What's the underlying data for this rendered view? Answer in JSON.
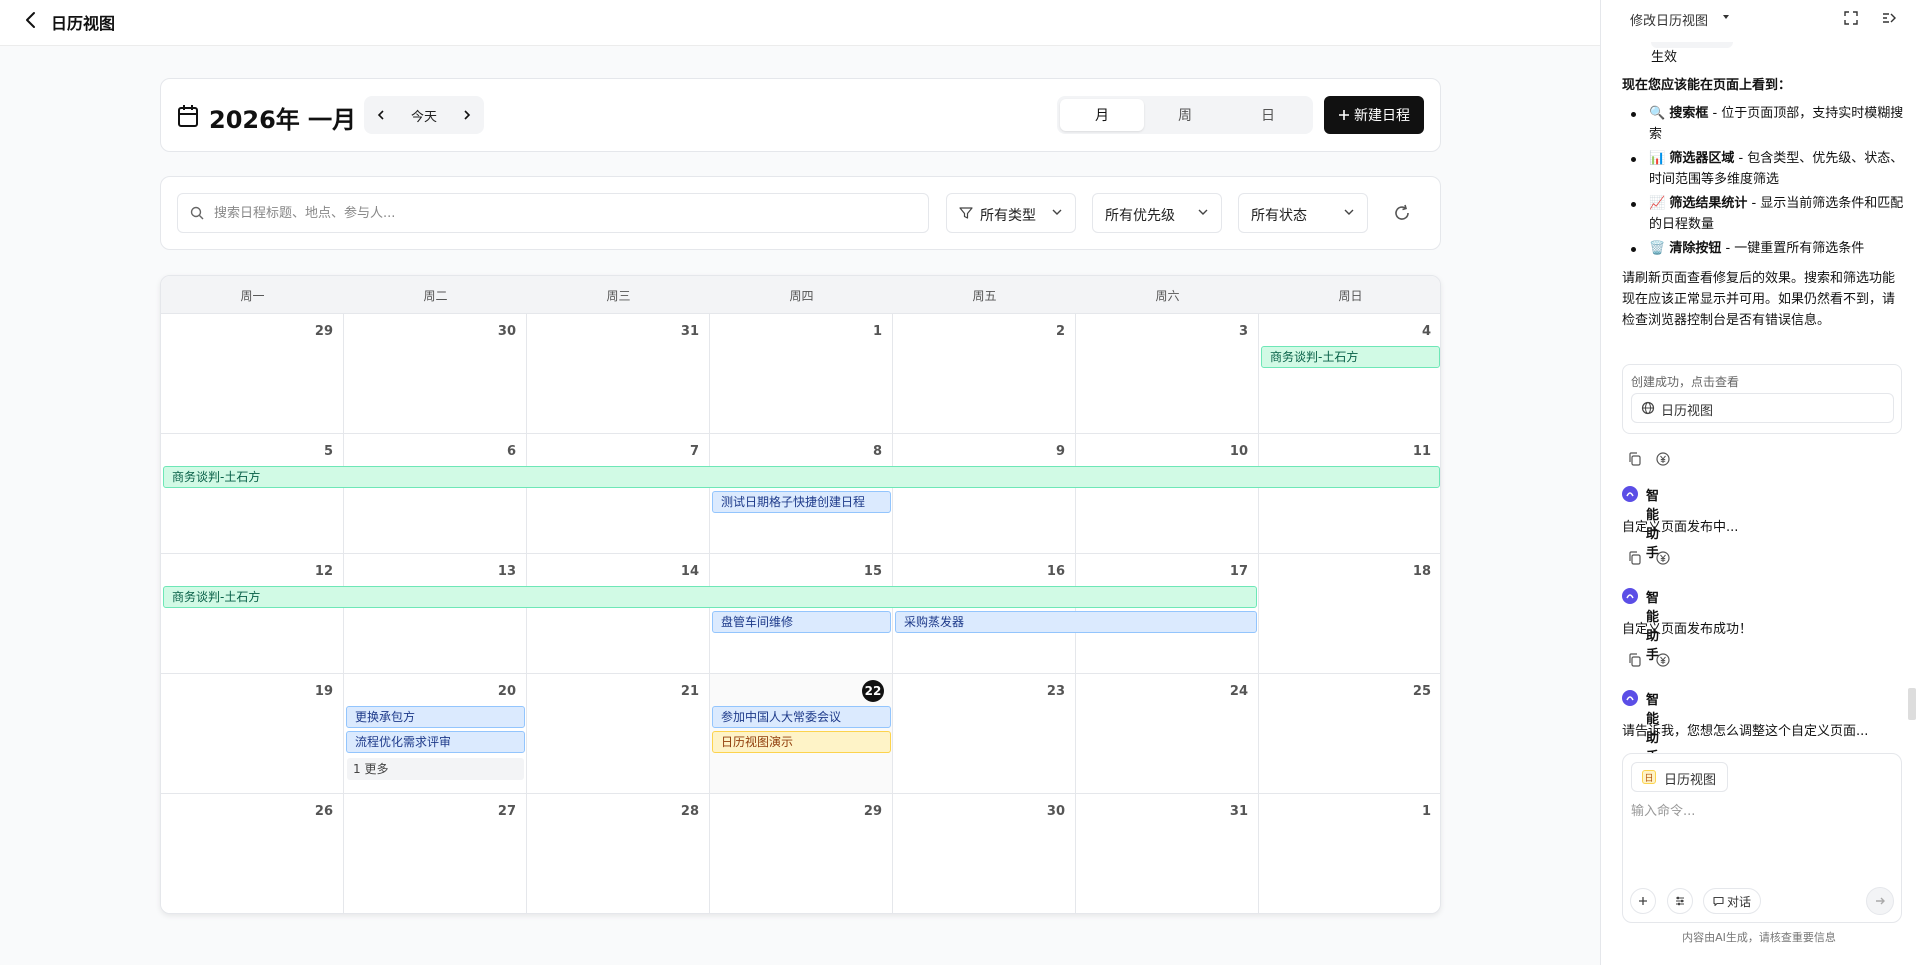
{
  "page": {
    "title": "日历视图"
  },
  "calendar": {
    "month_title": "2026年 一月",
    "today_label": "今天",
    "views": [
      "月",
      "周",
      "日"
    ],
    "active_view": "月",
    "new_button": "新建日程",
    "search_placeholder": "搜索日程标题、地点、参与人...",
    "filters": {
      "type": "所有类型",
      "priority": "所有优先级",
      "status": "所有状态"
    },
    "weekdays": [
      "周一",
      "周二",
      "周三",
      "周四",
      "周五",
      "周六",
      "周日"
    ],
    "weeks": [
      [
        "29",
        "30",
        "31",
        "1",
        "2",
        "3",
        "4"
      ],
      [
        "5",
        "6",
        "7",
        "8",
        "9",
        "10",
        "11"
      ],
      [
        "12",
        "13",
        "14",
        "15",
        "16",
        "17",
        "18"
      ],
      [
        "19",
        "20",
        "21",
        "22",
        "23",
        "24",
        "25"
      ],
      [
        "26",
        "27",
        "28",
        "29",
        "30",
        "31",
        "1"
      ]
    ],
    "today": {
      "week": 3,
      "day": 3
    },
    "colors": {
      "green": "#d1fae5",
      "blue": "#dbeafe",
      "yellow": "#fef3c7"
    },
    "events": [
      {
        "title": "商务谈判-土石方",
        "week": 0,
        "start": 6,
        "span": 1,
        "lane": 0,
        "color": "green"
      },
      {
        "title": "商务谈判-土石方",
        "week": 1,
        "start": 0,
        "span": 7,
        "lane": 0,
        "color": "green"
      },
      {
        "title": "测试日期格子快捷创建日程",
        "week": 1,
        "start": 3,
        "span": 1,
        "lane": 1,
        "color": "blue"
      },
      {
        "title": "商务谈判-土石方",
        "week": 2,
        "start": 0,
        "span": 6,
        "lane": 0,
        "color": "green"
      },
      {
        "title": "盘管车间维修",
        "week": 2,
        "start": 3,
        "span": 1,
        "lane": 1,
        "color": "blue"
      },
      {
        "title": "采购蒸发器",
        "week": 2,
        "start": 4,
        "span": 2,
        "lane": 1,
        "color": "blue"
      },
      {
        "title": "更换承包方",
        "week": 3,
        "start": 1,
        "span": 1,
        "lane": 0,
        "color": "blue"
      },
      {
        "title": "流程优化需求评审",
        "week": 3,
        "start": 1,
        "span": 1,
        "lane": 1,
        "color": "blue"
      },
      {
        "title": "参加中国人大常委会议",
        "week": 3,
        "start": 3,
        "span": 1,
        "lane": 0,
        "color": "blue"
      },
      {
        "title": "日历视图演示",
        "week": 3,
        "start": 3,
        "span": 1,
        "lane": 1,
        "color": "yellow"
      }
    ],
    "more": [
      {
        "label": "1 更多",
        "week": 3,
        "day": 1,
        "lane": 2
      }
    ]
  },
  "panel": {
    "title": "修改日历视图",
    "prev_tail": "生效",
    "intro": "现在您应该能在页面上看到：",
    "bullets": [
      {
        "emoji": "🔍",
        "bold": "搜索框",
        "text": " - 位于页面顶部，支持实时模糊搜索"
      },
      {
        "emoji": "📊",
        "bold": "筛选器区域",
        "text": " - 包含类型、优先级、状态、时间范围等多维度筛选"
      },
      {
        "emoji": "📈",
        "bold": "筛选结果统计",
        "text": " - 显示当前筛选条件和匹配的日程数量"
      },
      {
        "emoji": "🗑️",
        "bold": "清除按钮",
        "text": " - 一键重置所有筛选条件"
      }
    ],
    "summary": "请刷新页面查看修复后的效果。搜索和筛选功能现在应该正常显示并可用。如果仍然看不到，请检查浏览器控制台是否有错误信息。",
    "created_label": "创建成功，点击查看",
    "created_link": "日历视图",
    "assistant_name": "智能助手",
    "messages": [
      "自定义页面发布中...",
      "自定义页面发布成功！",
      "请告诉我，您想怎么调整这个自定义页面..."
    ],
    "context_chip": "日历视图",
    "context_chip_icon": "日",
    "input_placeholder": "输入命令...",
    "mode_label": "对话",
    "disclaimer": "内容由AI生成，请核查重要信息"
  }
}
